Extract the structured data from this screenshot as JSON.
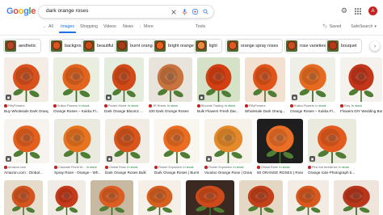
{
  "header": {
    "logo_letters": [
      "G",
      "o",
      "o",
      "g",
      "l",
      "e"
    ],
    "logo_colors": [
      "#4285f4",
      "#ea4335",
      "#fbbc05",
      "#4285f4",
      "#34a853",
      "#ea4335"
    ],
    "query": "dark orange roses",
    "avatar_letter": "A"
  },
  "tabs": {
    "items": [
      {
        "label": "All",
        "icon": "arrow-left"
      },
      {
        "label": "Images"
      },
      {
        "label": "Shopping"
      },
      {
        "label": "Videos"
      },
      {
        "label": "News"
      },
      {
        "label": "More"
      }
    ],
    "tools": "Tools",
    "saved": "Saved",
    "safesearch": "SafeSearch"
  },
  "chips": [
    {
      "label": "aesthetic",
      "color": "#b4462a"
    },
    {
      "label": "background",
      "color": "#d9541e"
    },
    {
      "label": "beautiful",
      "color": "#c94a19"
    },
    {
      "label": "burnt orange",
      "color": "#a83d1c"
    },
    {
      "label": "bright orange",
      "color": "#e8601c"
    },
    {
      "label": "light",
      "color": "#e88a3f"
    },
    {
      "label": "orange spray roses",
      "color": "#dd5a22"
    },
    {
      "label": "rose varieties",
      "color": "#c64f24"
    },
    {
      "label": "bouquet",
      "color": "#b8391a"
    }
  ],
  "rows": [
    {
      "items": [
        {
          "source": "FiftyFlowers",
          "stock": "",
          "title": "Buy Wholesale Dark Orange Ro...",
          "color": "#d9511d",
          "bg": "#f3ede6"
        },
        {
          "source": "Kukka Flowers",
          "stock": "In stock",
          "title": "Orange Roses – Kukka Fl...",
          "color": "#e2641f",
          "bg": "#e9eee0"
        },
        {
          "source": "Flower Moxie",
          "stock": "In stock",
          "title": "Dark Orange Bloomz ...",
          "color": "#d34a18",
          "bg": "#e4ecdd"
        },
        {
          "source": "JR Roses",
          "stock": "In stock",
          "title": "100 Dark Orange Roses",
          "color": "#c8733e",
          "bg": "#e9e4db"
        },
        {
          "source": "Bloomie Trading",
          "stock": "In stock",
          "title": "Bulk Flowers Fresh Dar...",
          "color": "#d43f12",
          "bg": "#d5e2c8"
        },
        {
          "source": "FiftyFlowers",
          "stock": "",
          "title": "Wholesale Dark Orang...",
          "color": "#e05419",
          "bg": "#f2e0d0"
        },
        {
          "source": "Kukka Flowers",
          "stock": "In stock",
          "title": "Orange Roses – Kukka Fl...",
          "color": "#e66b21",
          "bg": "#eef0e8"
        },
        {
          "source": "Etsy",
          "stock": "In stock",
          "title": "Flowers DIY Wedding Bou...",
          "color": "#c2361a",
          "bg": "#f5f2ee"
        }
      ]
    },
    {
      "items": [
        {
          "source": "Amazon.com",
          "stock": "",
          "title": "Amazon.com : Global...",
          "color": "#e4601f",
          "bg": "#f7f3ee"
        },
        {
          "source": "Cascade Floral W...",
          "stock": "In stock",
          "title": "Spray Rose - Orange - Wh...",
          "color": "#e9741f",
          "bg": "#eaeae0"
        },
        {
          "source": "Global Rose",
          "stock": "In stock",
          "title": "Dark Orange Roses Bulk",
          "color": "#d8561c",
          "bg": "#f0ebe3"
        },
        {
          "source": "Flower Explosion",
          "stock": "In stock",
          "title": "Dark Orange Roses | Burnt Orange ...",
          "color": "#ea6d22",
          "bg": "#f9f6f0"
        },
        {
          "source": "Flower Explosion",
          "stock": "In stock",
          "title": "Voodoo Orange Rose | Orang...",
          "color": "#e58a2a",
          "bg": "#f6f2ea"
        },
        {
          "source": "Global Rose",
          "stock": "In stock",
          "title": "50 ORANGE ROSES | Rosen...",
          "color": "#ea6e26",
          "bg": "#1e1e1e"
        },
        {
          "source": "Pink Ant Ambience",
          "stock": "In stock",
          "title": "Orange rose Photograph b...",
          "color": "#e25a1e",
          "bg": "#eaeadf"
        }
      ]
    },
    {
      "items": [
        {
          "color": "#d4541f",
          "bg": "#e6dccc"
        },
        {
          "color": "#c73a1a",
          "bg": "#f0ece5"
        },
        {
          "color": "#dc5e22",
          "bg": "#c8b9a2"
        },
        {
          "color": "#d6601f",
          "bg": "#f5efe8"
        },
        {
          "color": "#cf4a1b",
          "bg": "#3b2a22"
        },
        {
          "color": "#c2401a",
          "bg": "#e4d8c4"
        },
        {
          "color": "#d9581e",
          "bg": "#f2ece4"
        },
        {
          "color": "#b8371a",
          "bg": "#eee6dc"
        }
      ]
    }
  ]
}
